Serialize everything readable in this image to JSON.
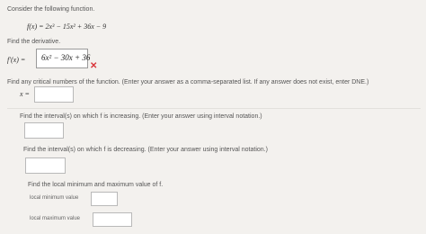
{
  "intro": "Consider the following function.",
  "function_expr": "f(x) = 2x³ − 15x² + 36x − 9",
  "derivative_prompt": "Find the derivative.",
  "derivative_label": "f′(x) =",
  "derivative_answer": "6x² − 30x + 36",
  "derivative_status_icon": "incorrect-x-icon",
  "critical_prompt": "Find any critical numbers of the function. (Enter your answer as a comma-separated list. If any answer does not exist, enter DNE.)",
  "critical_label": "x =",
  "critical_value": "",
  "increasing_prompt": "Find the interval(s) on which f is increasing. (Enter your answer using interval notation.)",
  "increasing_value": "",
  "decreasing_prompt": "Find the interval(s) on which f is decreasing. (Enter your answer using interval notation.)",
  "decreasing_value": "",
  "local_prompt": "Find the local minimum and maximum value of f.",
  "local_min_label": "local minimum value",
  "local_min_value": "",
  "local_max_label": "local maximum value",
  "local_max_value": "",
  "colors": {
    "background": "#f3f1ee",
    "error": "#d9343a",
    "text": "#555555"
  }
}
